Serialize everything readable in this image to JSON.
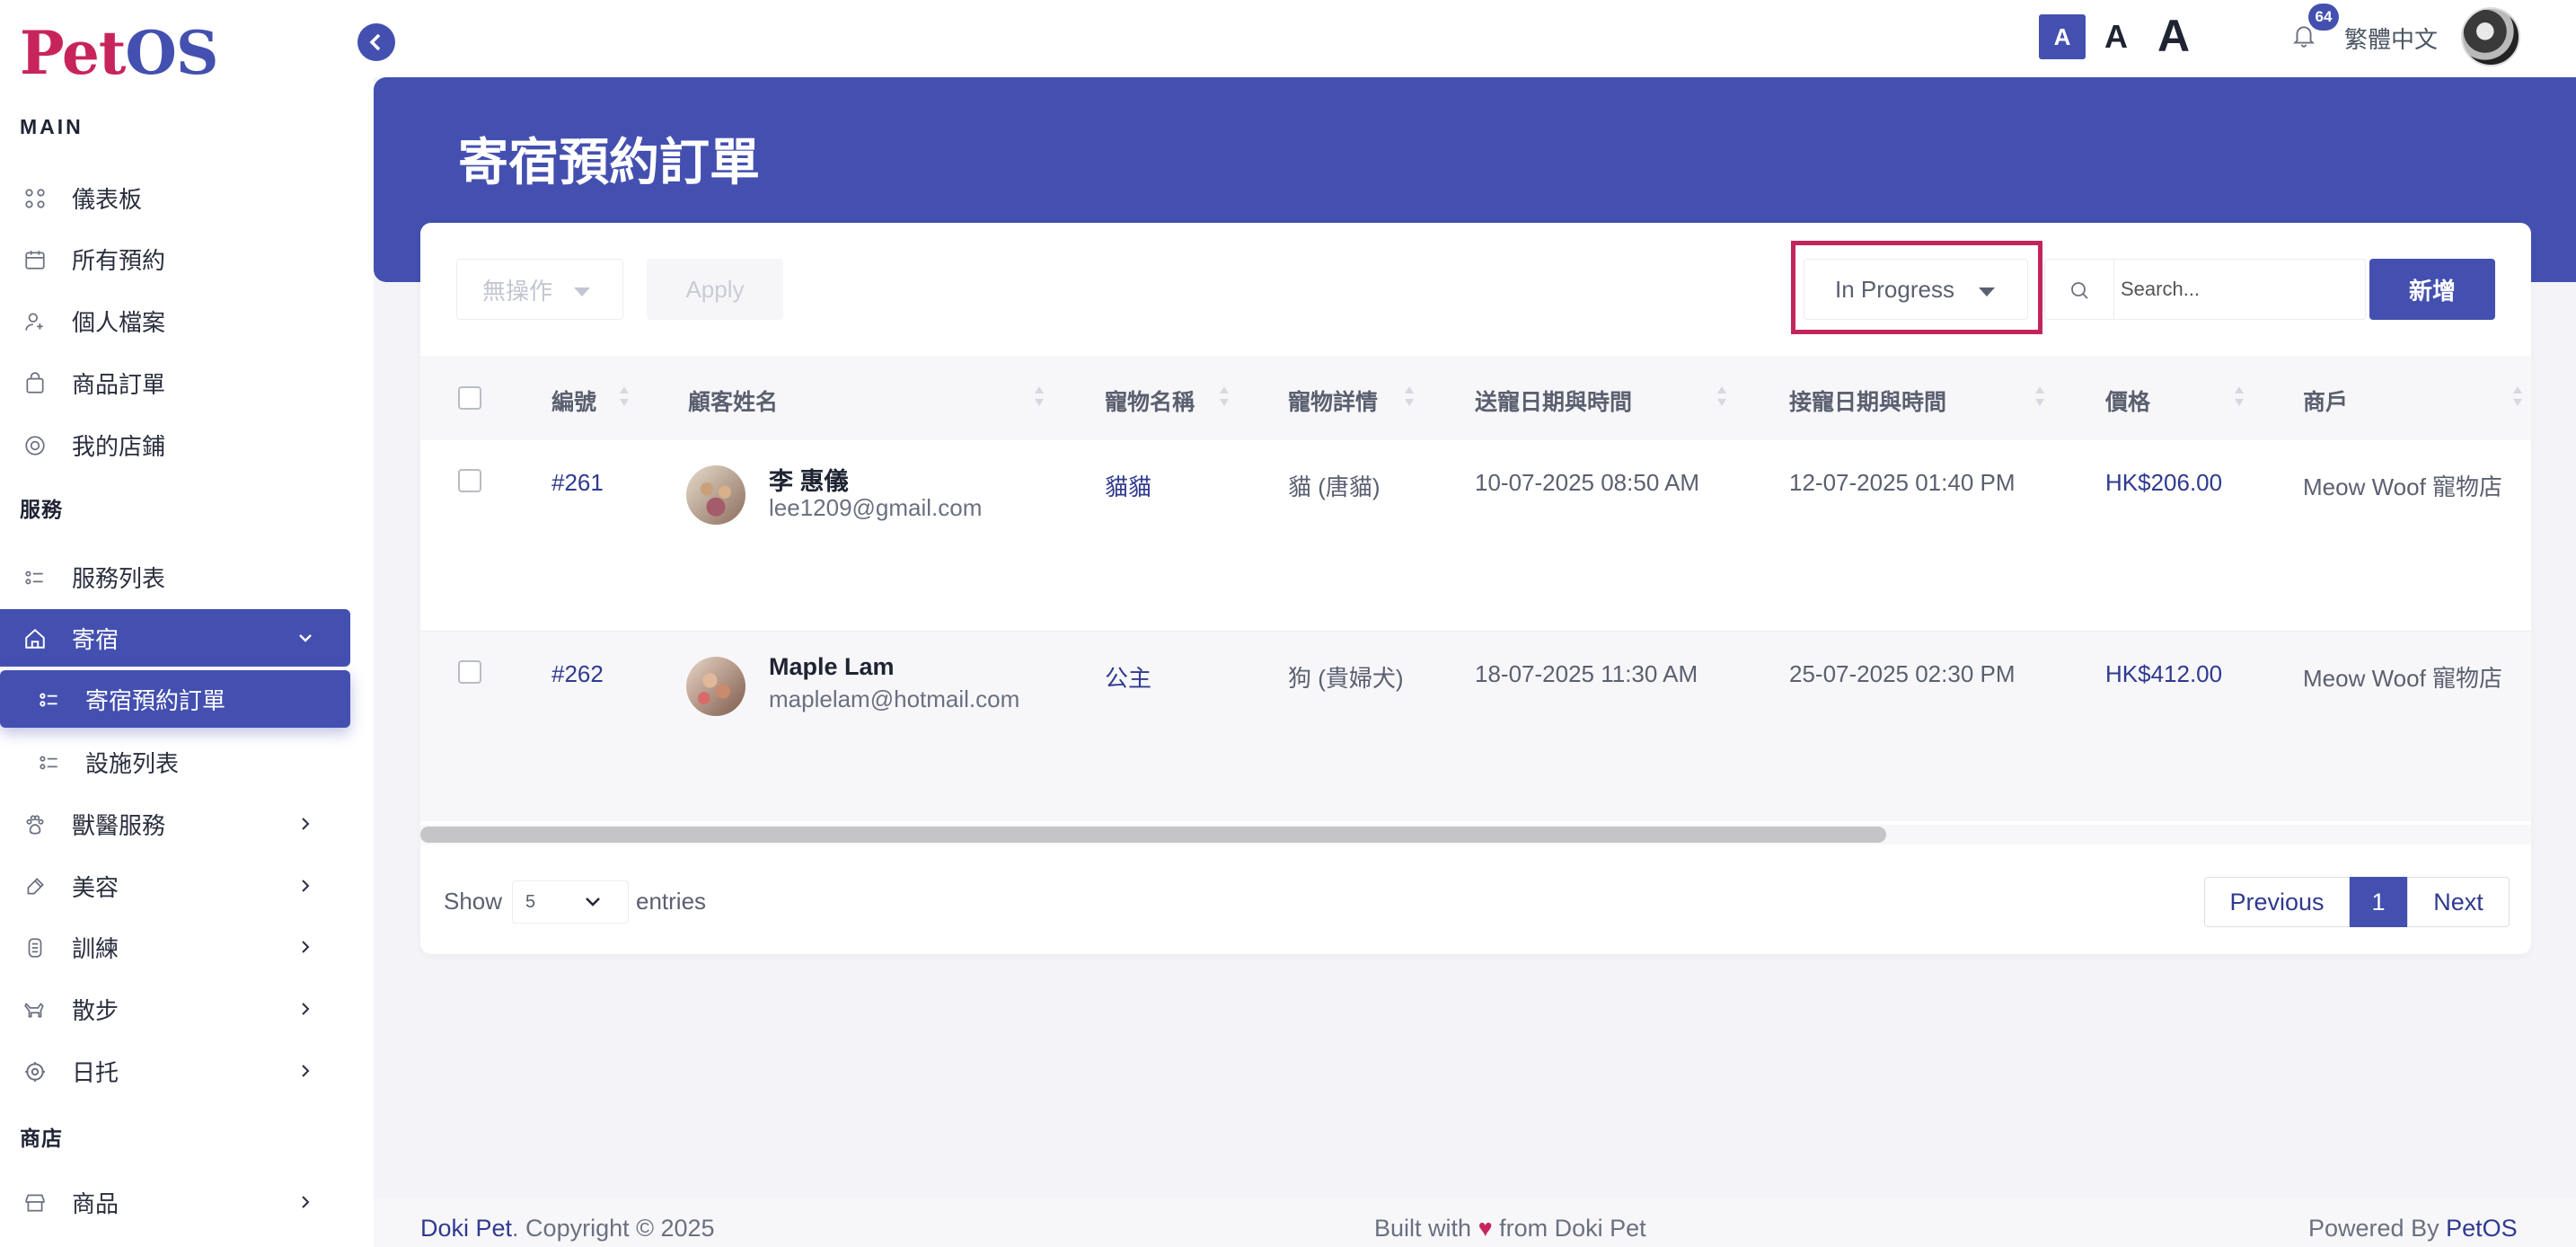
{
  "brand": {
    "logo_pet": "Pet",
    "logo_os": "OS"
  },
  "sidebar": {
    "main_title": "MAIN",
    "main_items": [
      {
        "label": "儀表板",
        "icon": "dashboard-icon"
      },
      {
        "label": "所有預約",
        "icon": "calendar-icon"
      },
      {
        "label": "個人檔案",
        "icon": "user-icon"
      },
      {
        "label": "商品訂單",
        "icon": "shopping-bag-icon"
      },
      {
        "label": "我的店鋪",
        "icon": "store-icon"
      }
    ],
    "service_title": "服務",
    "service_items": [
      {
        "label": "服務列表",
        "icon": "list-icon"
      },
      {
        "label": "寄宿",
        "icon": "home-icon",
        "expanded": true
      },
      {
        "label": "寄宿預約訂單",
        "icon": "list-icon",
        "active": true
      },
      {
        "label": "設施列表",
        "icon": "list-icon"
      },
      {
        "label": "獸醫服務",
        "icon": "paw-icon"
      },
      {
        "label": "美容",
        "icon": "brush-icon"
      },
      {
        "label": "訓練",
        "icon": "training-icon"
      },
      {
        "label": "散步",
        "icon": "walk-dog-icon"
      },
      {
        "label": "日托",
        "icon": "daycare-icon"
      }
    ],
    "shop_title": "商店",
    "shop_items": [
      {
        "label": "商品",
        "icon": "store-icon"
      }
    ]
  },
  "topbar": {
    "font_small": "A",
    "font_medium": "A",
    "font_large": "A",
    "notification_count": "64",
    "language": "繁體中文"
  },
  "page": {
    "title": "寄宿預約訂單"
  },
  "toolbar": {
    "bulk_action": "無操作",
    "apply_label": "Apply",
    "status_filter": "In Progress",
    "search_placeholder": "Search...",
    "add_label": "新增"
  },
  "table": {
    "columns": [
      "編號",
      "顧客姓名",
      "寵物名稱",
      "寵物詳情",
      "送寵日期與時間",
      "接寵日期與時間",
      "價格",
      "商戶"
    ],
    "rows": [
      {
        "id": "#261",
        "customer_name": "李 惠儀",
        "customer_email": "lee1209@gmail.com",
        "pet_name": "貓貓",
        "pet_details": "貓 (唐貓)",
        "drop_off": "10-07-2025 08:50 AM",
        "pick_up": "12-07-2025 01:40 PM",
        "price": "HK$206.00",
        "merchant": "Meow Woof 寵物店"
      },
      {
        "id": "#262",
        "customer_name": "Maple Lam",
        "customer_email": "maplelam@hotmail.com",
        "pet_name": "公主",
        "pet_details": "狗 (貴婦犬)",
        "drop_off": "18-07-2025 11:30 AM",
        "pick_up": "25-07-2025 02:30 PM",
        "price": "HK$412.00",
        "merchant": "Meow Woof 寵物店"
      }
    ]
  },
  "pagination": {
    "show_label": "Show",
    "page_size": "5",
    "entries_label": "entries",
    "previous": "Previous",
    "current": "1",
    "next": "Next"
  },
  "footer": {
    "company": "Doki Pet",
    "copyright": ". Copyright © 2025",
    "built_with": "Built with",
    "heart": "♥",
    "from": "from Doki Pet",
    "powered_by": "Powered By",
    "powered_name": "PetOS"
  },
  "colors": {
    "primary": "#4450b0",
    "brand_pink": "#c8245c",
    "highlight_border": "#c2255c"
  }
}
